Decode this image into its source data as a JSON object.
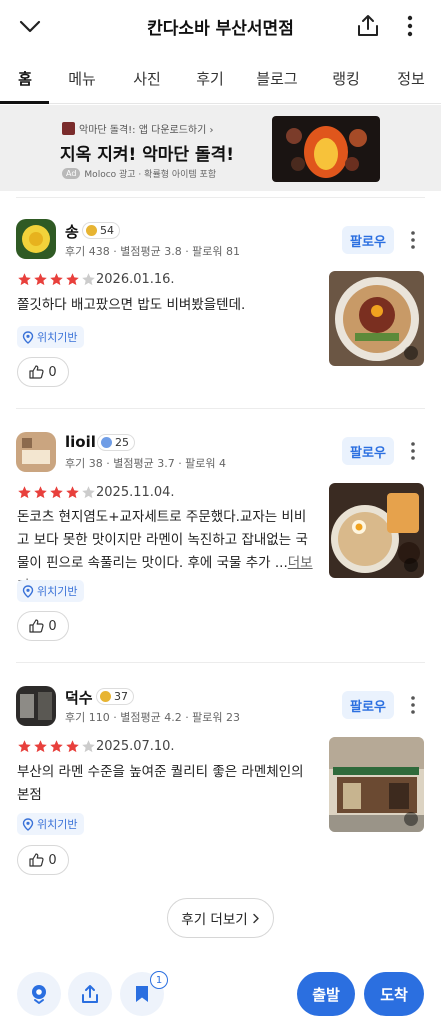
{
  "header": {
    "title": "칸다소바 부산서면점"
  },
  "tabs": [
    "홈",
    "메뉴",
    "사진",
    "후기",
    "블로그",
    "랭킹",
    "정보"
  ],
  "ad": {
    "sub": "악마단 돌격!: 앱 다운로드하기 ›",
    "headline": "지옥 지켜! 악마단 돌격!",
    "badge": "Ad",
    "meta": "Moloco 광고 · 확률형 아이템 포함"
  },
  "reviews": [
    {
      "name": "송",
      "level": "54",
      "stats": "후기 438 · 별점평균 3.8 · 팔로워 81",
      "follow": "팔로우",
      "rating": 4,
      "date": "2026.01.16.",
      "text": "쫄깃하다 배고팠으면 밥도 비벼봤을텐데.",
      "more": "",
      "tag": "위치기반",
      "likes": "0"
    },
    {
      "name": "lioil",
      "level": "25",
      "stats": "후기 38 · 별점평균 3.7 · 팔로워 4",
      "follow": "팔로우",
      "rating": 4,
      "date": "2025.11.04.",
      "text": "돈코츠 현지염도+교자세트로 주문했다.교자는 비비고 보다 못한 맛이지만 라멘이 녹진하고 잡내없는 국물이 핀으로 속풀리는 맛이다. 후에 국물 추가 ...",
      "more": "더보기",
      "tag": "위치기반",
      "likes": "0"
    },
    {
      "name": "덕수",
      "level": "37",
      "stats": "후기 110 · 별점평균 4.2 · 팔로워 23",
      "follow": "팔로우",
      "rating": 4,
      "date": "2025.07.10.",
      "text": "부산의 라멘 수준을 높여준 퀄리티 좋은 라멘체인의 본점",
      "more": "",
      "tag": "위치기반",
      "likes": "0"
    }
  ],
  "more_reviews": "후기 더보기",
  "bottom": {
    "saved_count": "1",
    "depart": "출발",
    "arrive": "도착"
  },
  "colors": {
    "accent": "#2b6fe0",
    "star": "#e8403c",
    "star_empty": "#cccccc"
  }
}
